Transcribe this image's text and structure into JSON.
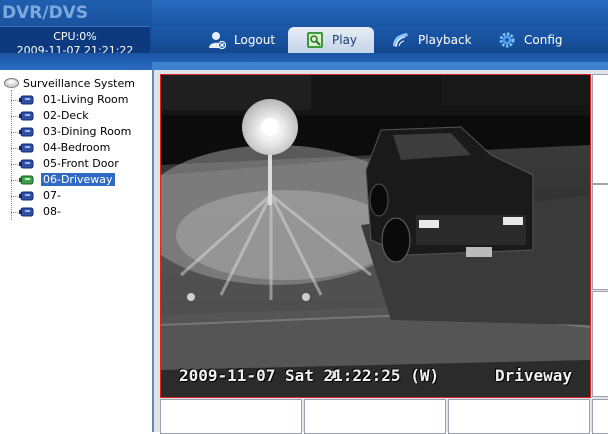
{
  "app": {
    "title": "DVR/DVS"
  },
  "status": {
    "cpu": "CPU:0%",
    "datetime": "2009-11-07 21:21:22"
  },
  "nav": {
    "logout": "Logout",
    "play": "Play",
    "playback": "Playback",
    "config": "Config",
    "active": "Play"
  },
  "tree": {
    "root": "Surveillance System",
    "channels": [
      {
        "label": "01-Living Room"
      },
      {
        "label": "02-Deck"
      },
      {
        "label": "03-Dining Room"
      },
      {
        "label": "04-Bedroom"
      },
      {
        "label": "05-Front Door"
      },
      {
        "label": "06-Driveway",
        "selected": true
      },
      {
        "label": "07-"
      },
      {
        "label": "08-"
      }
    ]
  },
  "video": {
    "osd_timestamp": "2009-11-07 Sat 21:22:25 (W)",
    "osd_channel": "Driveway"
  },
  "colors": {
    "header": "#1a4f9c",
    "selection": "#316ac5",
    "active_border": "#dd2222"
  }
}
